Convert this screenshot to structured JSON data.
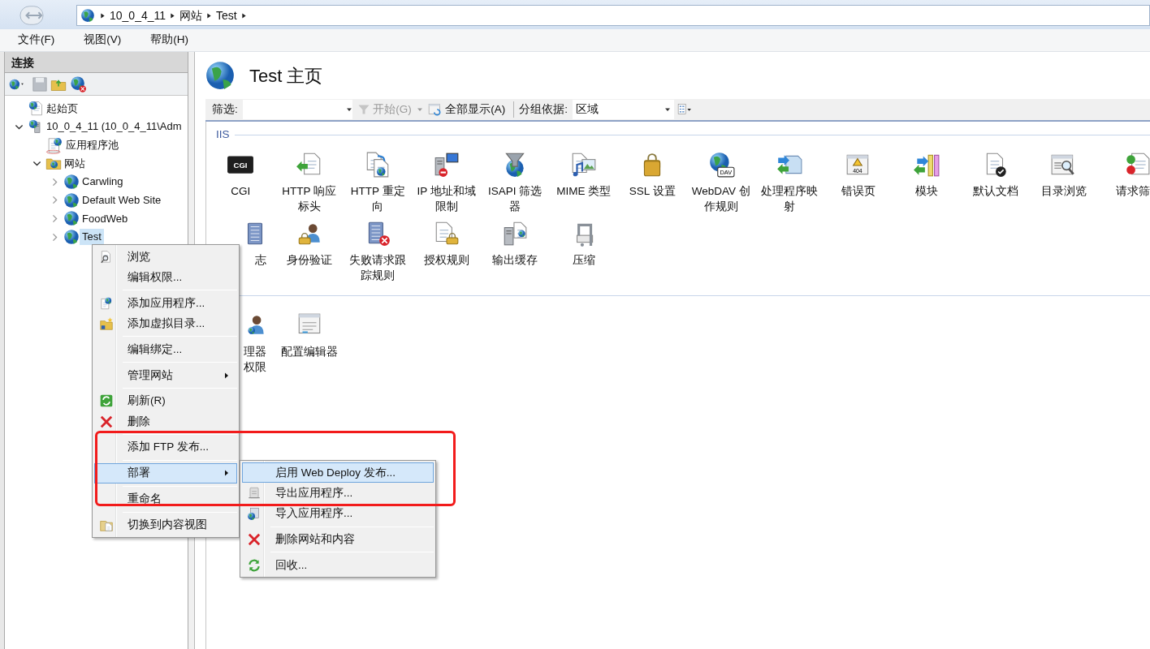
{
  "address_bar": {
    "crumbs": [
      "10_0_4_11",
      "网站",
      "Test"
    ]
  },
  "menu_bar": [
    "文件(F)",
    "视图(V)",
    "帮助(H)"
  ],
  "connections": {
    "title": "连接",
    "tree": [
      {
        "label": "起始页",
        "selected": false
      },
      {
        "label": "10_0_4_11 (10_0_4_11\\Adm",
        "selected": false,
        "expanded": true,
        "children": [
          {
            "label": "应用程序池",
            "selected": false
          },
          {
            "label": "网站",
            "selected": false,
            "expanded": true,
            "children": [
              {
                "label": "Carwling",
                "selected": false,
                "expanded": false
              },
              {
                "label": "Default Web Site",
                "selected": false,
                "expanded": false
              },
              {
                "label": "FoodWeb",
                "selected": false,
                "expanded": false
              },
              {
                "label": "Test",
                "selected": true,
                "expanded": false
              }
            ]
          }
        ]
      }
    ]
  },
  "page_title": "Test 主页",
  "filter_bar": {
    "filter_label": "筛选:",
    "start_button": "开始(G)",
    "start_disabled": true,
    "show_all_button": "全部显示(A)",
    "group_by_label": "分组依据:",
    "group_by_value": "区域"
  },
  "groups": [
    {
      "title": "IIS",
      "items": [
        {
          "label": "CGI",
          "icon_text": "CGI"
        },
        {
          "label": "HTTP 响应标头"
        },
        {
          "label": "HTTP 重定向"
        },
        {
          "label": "IP 地址和域限制"
        },
        {
          "label": "ISAPI 筛选器"
        },
        {
          "label": "MIME 类型"
        },
        {
          "label": "SSL 设置"
        },
        {
          "label": "WebDAV 创作规则",
          "icon_text": "DAV"
        },
        {
          "label": "处理程序映射"
        },
        {
          "label": "错误页",
          "icon_text": "404"
        },
        {
          "label": "模块"
        },
        {
          "label": "默认文档"
        },
        {
          "label": "目录浏览"
        },
        {
          "label": "请求筛",
          "cut_right": true
        },
        {
          "label": "志",
          "cut_left": true
        },
        {
          "label": "身份验证"
        },
        {
          "label": "失败请求跟踪规则"
        },
        {
          "label": "授权规则"
        },
        {
          "label": "输出缓存"
        },
        {
          "label": "压缩"
        }
      ]
    },
    {
      "items": [
        {
          "label": "理器权限",
          "cut_left": true
        },
        {
          "label": "配置编辑器"
        }
      ]
    }
  ],
  "context_menu": [
    {
      "kind": "item",
      "label": "浏览",
      "selected": false,
      "submenu": false
    },
    {
      "kind": "item",
      "label": "编辑权限...",
      "selected": false,
      "submenu": false
    },
    {
      "kind": "separator"
    },
    {
      "kind": "item",
      "label": "添加应用程序...",
      "selected": false,
      "submenu": false
    },
    {
      "kind": "item",
      "label": "添加虚拟目录...",
      "selected": false,
      "submenu": false
    },
    {
      "kind": "separator"
    },
    {
      "kind": "item",
      "label": "编辑绑定...",
      "selected": false,
      "submenu": false
    },
    {
      "kind": "separator"
    },
    {
      "kind": "item",
      "label": "管理网站",
      "selected": false,
      "submenu": true
    },
    {
      "kind": "separator"
    },
    {
      "kind": "item",
      "label": "刷新(R)",
      "selected": false,
      "submenu": false
    },
    {
      "kind": "item",
      "label": "删除",
      "selected": false,
      "submenu": false
    },
    {
      "kind": "separator"
    },
    {
      "kind": "item",
      "label": "添加 FTP 发布...",
      "selected": false,
      "submenu": false
    },
    {
      "kind": "separator"
    },
    {
      "kind": "item",
      "label": "部署",
      "selected": true,
      "submenu": true
    },
    {
      "kind": "separator"
    },
    {
      "kind": "item",
      "label": "重命名",
      "selected": false,
      "submenu": false
    },
    {
      "kind": "separator"
    },
    {
      "kind": "item",
      "label": "切换到内容视图",
      "selected": false,
      "submenu": false
    }
  ],
  "submenu": [
    {
      "kind": "item",
      "label": "启用 Web Deploy 发布...",
      "selected": true,
      "submenu": false
    },
    {
      "kind": "item",
      "label": "导出应用程序...",
      "selected": false,
      "submenu": false
    },
    {
      "kind": "item",
      "label": "导入应用程序...",
      "selected": false,
      "submenu": false
    },
    {
      "kind": "separator"
    },
    {
      "kind": "item",
      "label": "删除网站和内容",
      "selected": false,
      "submenu": false
    },
    {
      "kind": "separator"
    },
    {
      "kind": "item",
      "label": "回收...",
      "selected": false,
      "submenu": false
    }
  ]
}
